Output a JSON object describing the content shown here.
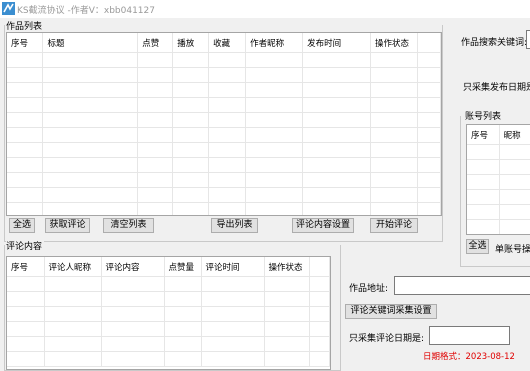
{
  "window": {
    "title": "KS截流协议 -作者V：xbb041127",
    "icon": "app-logo-icon"
  },
  "works": {
    "group_title": "作品列表",
    "columns": [
      "序号",
      "标题",
      "点赞",
      "播放",
      "收藏",
      "作者昵称",
      "发布时间",
      "操作状态"
    ],
    "buttons": {
      "select_all": "全选",
      "fetch_comments": "获取评论",
      "clear_list": "清空列表",
      "export_list": "导出列表",
      "comment_settings": "评论内容设置",
      "start_comment": "开始评论"
    }
  },
  "comments": {
    "group_title": "评论内容",
    "columns": [
      "序号",
      "评论人昵称",
      "评论内容",
      "点赞量",
      "评论时间",
      "操作状态"
    ]
  },
  "right": {
    "search_keyword_label": "作品搜索关键词:",
    "only_collect_date_label": "只采集发布日期是",
    "accounts_group_title": "账号列表",
    "accounts_columns": [
      "序号",
      "昵称"
    ],
    "select_all": "全选",
    "account_operation_label": "单账号操"
  },
  "bottom_right": {
    "work_url_label": "作品地址:",
    "work_url_value": "",
    "keyword_settings_button": "评论关键词采集设置",
    "comment_date_label": "只采集评论日期是:",
    "comment_date_value": "",
    "date_format_hint": "日期格式：2023-08-12"
  }
}
